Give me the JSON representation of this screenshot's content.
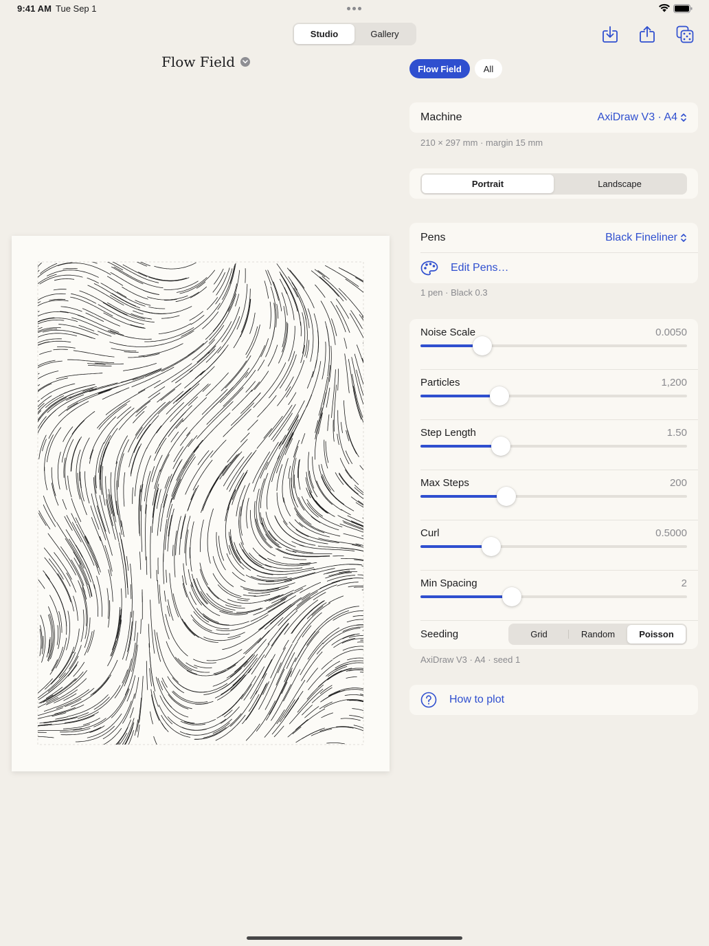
{
  "status": {
    "time": "9:41 AM",
    "date": "Tue Sep 1"
  },
  "toolbar": {
    "tabs": [
      {
        "label": "Studio",
        "selected": true
      },
      {
        "label": "Gallery",
        "selected": false
      }
    ],
    "icons": [
      "download-icon",
      "share-icon",
      "dice-icon"
    ]
  },
  "document": {
    "title": "Flow Field"
  },
  "filters": {
    "active": "Flow Field",
    "other": "All"
  },
  "machine": {
    "label": "Machine",
    "value": "AxiDraw V3 · A4",
    "caption": "210 × 297 mm · margin 15 mm"
  },
  "orientation": {
    "options": [
      "Portrait",
      "Landscape"
    ],
    "selected": "Portrait"
  },
  "pens": {
    "label": "Pens",
    "value": "Black Fineliner",
    "edit_label": "Edit Pens…",
    "caption": "1 pen · Black 0.3"
  },
  "params": [
    {
      "label": "Noise Scale",
      "value": "0.0050",
      "fraction": 0.231
    },
    {
      "label": "Particles",
      "value": "1,200",
      "fraction": 0.297
    },
    {
      "label": "Step Length",
      "value": "1.50",
      "fraction": 0.302
    },
    {
      "label": "Max Steps",
      "value": "200",
      "fraction": 0.323
    },
    {
      "label": "Curl",
      "value": "0.5000",
      "fraction": 0.266
    },
    {
      "label": "Min Spacing",
      "value": "2",
      "fraction": 0.344
    }
  ],
  "seeding": {
    "label": "Seeding",
    "options": [
      "Grid",
      "Random",
      "Poisson"
    ],
    "selected": "Poisson"
  },
  "summary": "AxiDraw V3 · A4 · seed 1",
  "help": {
    "label": "How to plot"
  },
  "colors": {
    "accent": "#2f4fcf",
    "background": "#f2efe9",
    "card": "#faf8f3",
    "paper": "#fcfbf7"
  }
}
